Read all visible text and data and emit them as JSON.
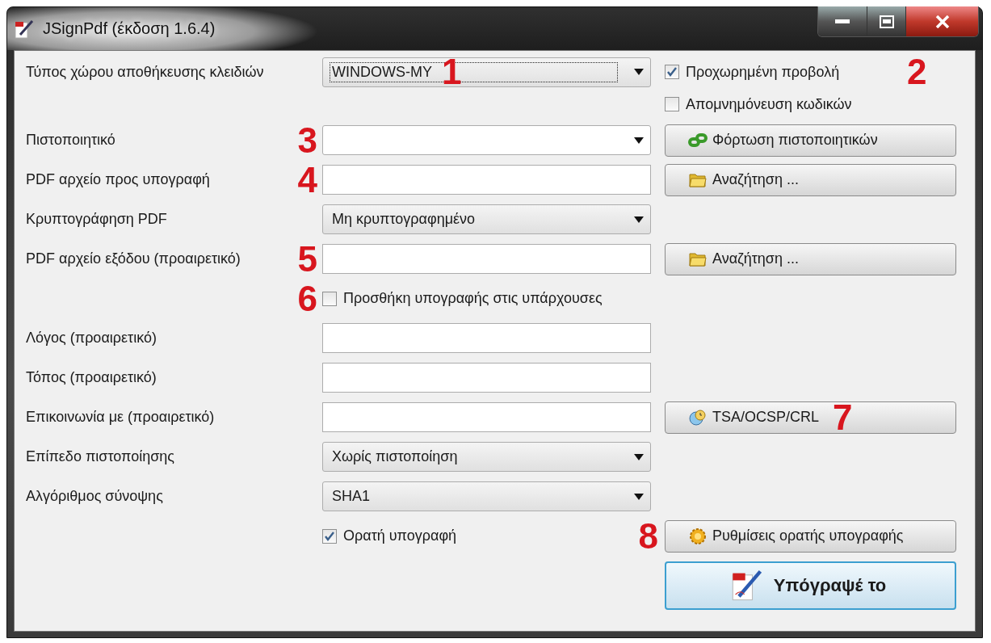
{
  "window": {
    "title": "JSignPdf (έκδοση 1.6.4)"
  },
  "rows": [
    {
      "label": "Τύπος χώρου αποθήκευσης κλειδιών",
      "field": {
        "kind": "combo",
        "value": "WINDOWS-MY",
        "focused": true
      },
      "marker": {
        "text": "1",
        "kind": "in-field"
      },
      "side": {
        "kind": "checkbox",
        "label": "Προχωρημένη προβολή",
        "checked": true
      },
      "side_marker": {
        "text": "2",
        "kind": "after-side"
      }
    },
    {
      "side": {
        "kind": "checkbox",
        "label": "Απομνημόνευση κωδικών",
        "checked": false
      }
    },
    {
      "label": "Πιστοποιητικό",
      "field": {
        "kind": "editable-combo",
        "focused": false
      },
      "marker": {
        "text": "3",
        "kind": "before-field"
      },
      "side": {
        "kind": "load",
        "label": "Φόρτωση πιστοποιητικών"
      }
    },
    {
      "label": "PDF αρχείο προς υπογραφή",
      "field": {
        "kind": "input"
      },
      "marker": {
        "text": "4",
        "kind": "before-field"
      },
      "side": {
        "kind": "browse",
        "label": "Αναζήτηση ..."
      }
    },
    {
      "label": "Κρυπτογράφηση PDF",
      "field": {
        "kind": "combo",
        "value": "Μη κρυπτογραφημένο",
        "focused": false
      }
    },
    {
      "label": "PDF αρχείο εξόδου (προαιρετικό)",
      "field": {
        "kind": "input"
      },
      "marker": {
        "text": "5",
        "kind": "before-field"
      },
      "side": {
        "kind": "browse",
        "label": "Αναζήτηση ..."
      }
    },
    {
      "field": {
        "kind": "checkbox",
        "label": "Προσθήκη υπογραφής στις υπάρχουσες",
        "checked": false
      },
      "marker": {
        "text": "6",
        "kind": "before-field"
      }
    },
    {
      "label": "Λόγος (προαιρετικό)",
      "field": {
        "kind": "input"
      }
    },
    {
      "label": "Τόπος (προαιρετικό)",
      "field": {
        "kind": "input"
      }
    },
    {
      "label": "Επικοινωνία με (προαιρετικό)",
      "field": {
        "kind": "input"
      },
      "side": {
        "kind": "tsa",
        "label": "TSA/OCSP/CRL"
      },
      "side_marker": {
        "text": "7",
        "kind": "in-side"
      }
    },
    {
      "label": "Επίπεδο πιστοποίησης",
      "field": {
        "kind": "combo",
        "value": "Χωρίς πιστοποίηση",
        "focused": false
      }
    },
    {
      "label": "Αλγόριθμος σύνοψης",
      "field": {
        "kind": "combo",
        "value": "SHA1",
        "focused": false
      }
    },
    {
      "field": {
        "kind": "checkbox",
        "label": "Ορατή υπογραφή",
        "checked": true
      },
      "side": {
        "kind": "settings",
        "label": "Ρυθμίσεις ορατής υπογραφής"
      },
      "side_marker": {
        "text": "8",
        "kind": "before-side"
      }
    },
    {
      "side": {
        "kind": "sign",
        "label": "Υπόγραψέ το"
      }
    }
  ]
}
